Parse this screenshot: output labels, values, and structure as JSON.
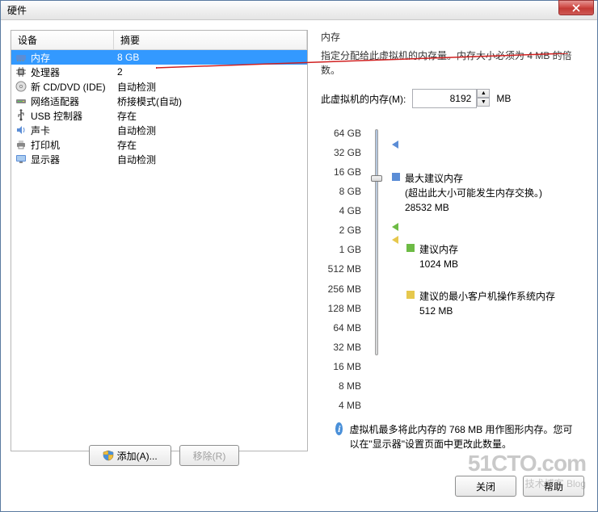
{
  "title": "硬件",
  "table": {
    "header_device": "设备",
    "header_summary": "摘要",
    "rows": [
      {
        "icon": "memory",
        "name": "内存",
        "summary": "8 GB",
        "selected": true
      },
      {
        "icon": "cpu",
        "name": "处理器",
        "summary": "2"
      },
      {
        "icon": "cd",
        "name": "新 CD/DVD (IDE)",
        "summary": "自动检测"
      },
      {
        "icon": "network",
        "name": "网络适配器",
        "summary": "桥接模式(自动)"
      },
      {
        "icon": "usb",
        "name": "USB 控制器",
        "summary": "存在"
      },
      {
        "icon": "sound",
        "name": "声卡",
        "summary": "自动检测"
      },
      {
        "icon": "printer",
        "name": "打印机",
        "summary": "存在"
      },
      {
        "icon": "display",
        "name": "显示器",
        "summary": "自动检测"
      }
    ]
  },
  "right": {
    "section_title": "内存",
    "desc": "指定分配给此虚拟机的内存量。内存大小必须为 4 MB 的倍数。",
    "input_label": "此虚拟机的内存(M):",
    "input_value": "8192",
    "input_unit": "MB",
    "ticks": [
      "64 GB",
      "32 GB",
      "16 GB",
      "8 GB",
      "4 GB",
      "2 GB",
      "1 GB",
      "512 MB",
      "256 MB",
      "128 MB",
      "64 MB",
      "32 MB",
      "16 MB",
      "8 MB",
      "4 MB"
    ],
    "markers": {
      "max_title": "最大建议内存",
      "max_note": "(超出此大小可能发生内存交换。)",
      "max_value": "28532 MB",
      "rec_title": "建议内存",
      "rec_value": "1024 MB",
      "min_title": "建议的最小客户机操作系统内存",
      "min_value": "512 MB"
    },
    "info": "虚拟机最多将此内存的 768 MB 用作图形内存。您可以在\"显示器\"设置页面中更改此数量。"
  },
  "buttons": {
    "add": "添加(A)...",
    "remove": "移除(R)",
    "close": "关闭",
    "help": "帮助"
  },
  "watermark": {
    "line1": "51CTO.com",
    "line2": "技术博客    Blog"
  }
}
